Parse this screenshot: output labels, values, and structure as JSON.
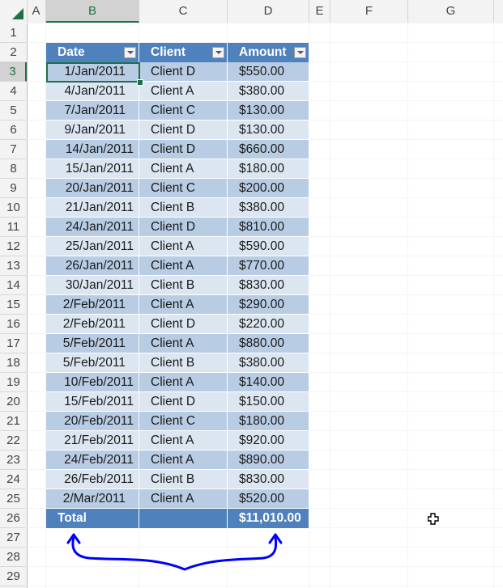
{
  "sheet": {
    "columns": [
      "A",
      "B",
      "C",
      "D",
      "E",
      "F",
      "G"
    ],
    "selected_column": "B",
    "rows": [
      "1",
      "2",
      "3",
      "4",
      "5",
      "6",
      "7",
      "8",
      "9",
      "10",
      "11",
      "12",
      "13",
      "14",
      "15",
      "16",
      "17",
      "18",
      "19",
      "20",
      "21",
      "22",
      "23",
      "24",
      "25",
      "26",
      "27",
      "28",
      "29"
    ],
    "selected_row": "3",
    "active_cell": "B3"
  },
  "table": {
    "headers": [
      "Date",
      "Client",
      "Amount"
    ],
    "rows": [
      [
        "1/Jan/2011",
        "Client D",
        "$550.00"
      ],
      [
        "4/Jan/2011",
        "Client A",
        "$380.00"
      ],
      [
        "7/Jan/2011",
        "Client C",
        "$130.00"
      ],
      [
        "9/Jan/2011",
        "Client D",
        "$130.00"
      ],
      [
        "14/Jan/2011",
        "Client D",
        "$660.00"
      ],
      [
        "15/Jan/2011",
        "Client A",
        "$180.00"
      ],
      [
        "20/Jan/2011",
        "Client C",
        "$200.00"
      ],
      [
        "21/Jan/2011",
        "Client B",
        "$380.00"
      ],
      [
        "24/Jan/2011",
        "Client D",
        "$810.00"
      ],
      [
        "25/Jan/2011",
        "Client A",
        "$590.00"
      ],
      [
        "26/Jan/2011",
        "Client A",
        "$770.00"
      ],
      [
        "30/Jan/2011",
        "Client B",
        "$830.00"
      ],
      [
        "2/Feb/2011",
        "Client A",
        "$290.00"
      ],
      [
        "2/Feb/2011",
        "Client D",
        "$220.00"
      ],
      [
        "5/Feb/2011",
        "Client A",
        "$880.00"
      ],
      [
        "5/Feb/2011",
        "Client B",
        "$380.00"
      ],
      [
        "10/Feb/2011",
        "Client A",
        "$140.00"
      ],
      [
        "15/Feb/2011",
        "Client D",
        "$150.00"
      ],
      [
        "20/Feb/2011",
        "Client C",
        "$180.00"
      ],
      [
        "21/Feb/2011",
        "Client A",
        "$920.00"
      ],
      [
        "24/Feb/2011",
        "Client A",
        "$890.00"
      ],
      [
        "26/Feb/2011",
        "Client B",
        "$830.00"
      ],
      [
        "2/Mar/2011",
        "Client A",
        "$520.00"
      ]
    ],
    "total": {
      "label": "Total",
      "client": "",
      "amount": "$11,010.00"
    }
  },
  "colors": {
    "header_blue": "#4f81bd",
    "band_dark": "#b8cce4",
    "band_light": "#dce6f1",
    "excel_green": "#1e7145",
    "annotation_arrow": "#0000ff"
  }
}
